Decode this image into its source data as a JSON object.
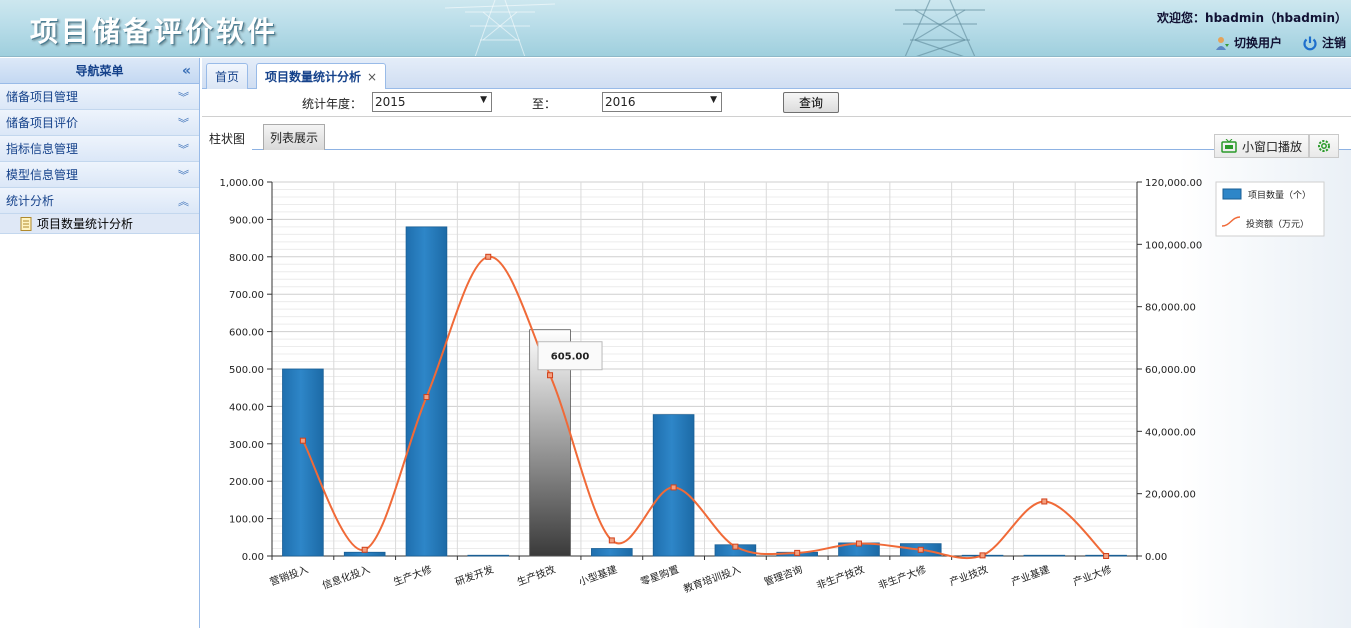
{
  "app": {
    "title": "项目储备评价软件",
    "welcome": "欢迎您：hbadmin（hbadmin）",
    "switch_user": "切换用户",
    "logout": "注销"
  },
  "sidebar": {
    "header": "导航菜单",
    "groups": [
      {
        "label": "储备项目管理",
        "expanded": false
      },
      {
        "label": "储备项目评价",
        "expanded": false
      },
      {
        "label": "指标信息管理",
        "expanded": false
      },
      {
        "label": "模型信息管理",
        "expanded": false
      },
      {
        "label": "统计分析",
        "expanded": true
      }
    ],
    "sub_items": [
      {
        "label": "项目数量统计分析"
      }
    ]
  },
  "tabs": [
    {
      "label": "首页",
      "active": false
    },
    {
      "label": "项目数量统计分析",
      "active": true,
      "close": "×"
    }
  ],
  "query": {
    "year_label": "统计年度：",
    "from_year": "2015",
    "to_label": "至：",
    "to_year": "2016",
    "button": "查询"
  },
  "view_tabs": {
    "bar": "柱状图",
    "list": "列表展示"
  },
  "toolbar": {
    "mini_play": "小窗口播放",
    "mini_play_icon": "tv-icon",
    "settings_icon": "gear-icon"
  },
  "colors": {
    "bar": "#2e86c8",
    "line": "#f06a38",
    "accent": "#15428b"
  },
  "chart_data": {
    "type": "bar",
    "categories": [
      "营销投入",
      "信息化投入",
      "生产大修",
      "研发开发",
      "生产技改",
      "小型基建",
      "零星购置",
      "教育培训投入",
      "管理咨询",
      "非生产技改",
      "非生产大修",
      "产业技改",
      "产业基建",
      "产业大修"
    ],
    "series": [
      {
        "name": "项目数量（个）",
        "axis": "left",
        "type": "bar",
        "values": [
          500,
          10,
          880,
          2,
          605,
          20,
          378,
          30,
          10,
          35,
          33,
          2,
          2,
          2
        ]
      },
      {
        "name": "投资额（万元）",
        "axis": "right",
        "type": "line",
        "values": [
          37000,
          2000,
          51000,
          96000,
          58000,
          5000,
          22000,
          3000,
          1000,
          4000,
          2000,
          200,
          17500,
          0
        ]
      }
    ],
    "yticks_left": [
      "0.00",
      "100.00",
      "200.00",
      "300.00",
      "400.00",
      "500.00",
      "600.00",
      "700.00",
      "800.00",
      "900.00",
      "1,000.00"
    ],
    "yticks_right": [
      "0.00",
      "20,000.00",
      "40,000.00",
      "60,000.00",
      "80,000.00",
      "100,000.00",
      "120,000.00"
    ],
    "ylim_left": [
      0,
      1000
    ],
    "ylim_right": [
      0,
      120000
    ],
    "highlight_index": 4,
    "tooltip": "605.00",
    "legend_position": "top-right",
    "grid": true
  }
}
